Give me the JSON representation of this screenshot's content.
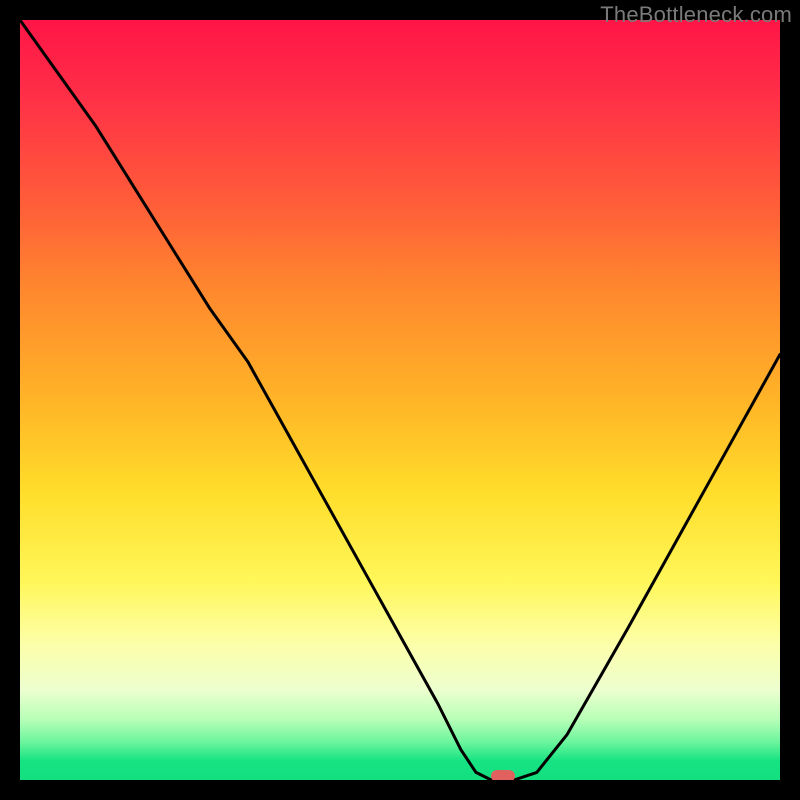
{
  "watermark": "TheBottleneck.com",
  "marker": {
    "x_frac": 0.635,
    "y_frac": 0.995,
    "color": "#e0615e"
  },
  "chart_data": {
    "type": "line",
    "title": "",
    "xlabel": "",
    "ylabel": "",
    "xlim": [
      0,
      1
    ],
    "ylim": [
      0,
      1
    ],
    "x": [
      0.0,
      0.05,
      0.1,
      0.15,
      0.2,
      0.25,
      0.3,
      0.35,
      0.4,
      0.45,
      0.5,
      0.55,
      0.58,
      0.6,
      0.62,
      0.65,
      0.68,
      0.72,
      0.76,
      0.8,
      0.85,
      0.9,
      0.95,
      1.0
    ],
    "values": [
      1.0,
      0.93,
      0.86,
      0.78,
      0.7,
      0.62,
      0.55,
      0.46,
      0.37,
      0.28,
      0.19,
      0.1,
      0.04,
      0.01,
      0.0,
      0.0,
      0.01,
      0.06,
      0.13,
      0.2,
      0.29,
      0.38,
      0.47,
      0.56
    ],
    "annotations": [
      {
        "text": "optimal point marker",
        "x": 0.635,
        "y": 0.0
      }
    ],
    "background_gradient": [
      {
        "stop": 0.0,
        "color": "#ff1547"
      },
      {
        "stop": 0.25,
        "color": "#ff6038"
      },
      {
        "stop": 0.5,
        "color": "#ffb427"
      },
      {
        "stop": 0.74,
        "color": "#fff75a"
      },
      {
        "stop": 0.88,
        "color": "#eeffcf"
      },
      {
        "stop": 1.0,
        "color": "#13df80"
      }
    ]
  }
}
